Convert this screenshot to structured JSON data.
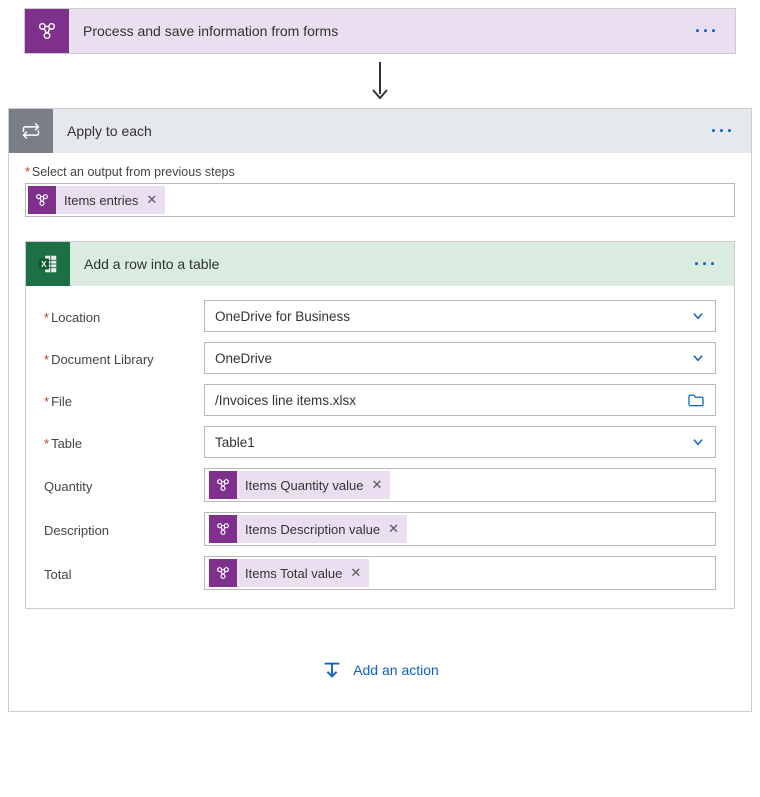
{
  "topAction": {
    "title": "Process and save information from forms"
  },
  "applyEach": {
    "title": "Apply to each",
    "outputLabel": "Select an output from previous steps",
    "outputToken": "Items entries"
  },
  "excelAction": {
    "title": "Add a row into a table",
    "fields": {
      "locationLabel": "Location",
      "locationValue": "OneDrive for Business",
      "docLibLabel": "Document Library",
      "docLibValue": "OneDrive",
      "fileLabel": "File",
      "fileValue": "/Invoices line items.xlsx",
      "tableLabel": "Table",
      "tableValue": "Table1",
      "quantityLabel": "Quantity",
      "quantityToken": "Items Quantity value",
      "descriptionLabel": "Description",
      "descriptionToken": "Items Description value",
      "totalLabel": "Total",
      "totalToken": "Items Total value"
    }
  },
  "addActionLabel": "Add an action"
}
